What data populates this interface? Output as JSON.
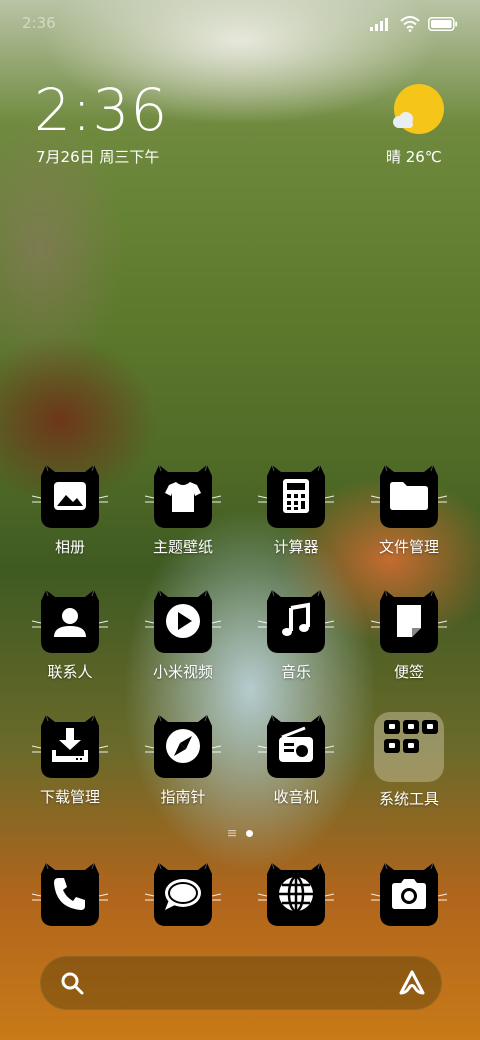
{
  "status_bar": {
    "time": "2:36",
    "battery_icon": "battery-icon",
    "wifi_icon": "wifi-icon",
    "signal_icon": "signal-icon"
  },
  "clock_widget": {
    "time": "2:36",
    "date": "7月26日 周三下午"
  },
  "weather": {
    "text": "晴 26℃",
    "icon": "sunny-cloud-icon"
  },
  "apps": [
    {
      "label": "相册",
      "icon": "gallery-icon"
    },
    {
      "label": "主题壁纸",
      "icon": "themes-icon"
    },
    {
      "label": "计算器",
      "icon": "calculator-icon"
    },
    {
      "label": "文件管理",
      "icon": "folder-icon"
    },
    {
      "label": "联系人",
      "icon": "contacts-icon"
    },
    {
      "label": "小米视频",
      "icon": "video-play-icon"
    },
    {
      "label": "音乐",
      "icon": "music-icon"
    },
    {
      "label": "便签",
      "icon": "notes-icon"
    },
    {
      "label": "下载管理",
      "icon": "download-icon"
    },
    {
      "label": "指南针",
      "icon": "compass-icon"
    },
    {
      "label": "收音机",
      "icon": "radio-icon"
    },
    {
      "label": "系统工具",
      "icon": "folder-group-icon"
    }
  ],
  "dock": [
    {
      "icon": "phone-icon"
    },
    {
      "icon": "messages-icon"
    },
    {
      "icon": "browser-icon"
    },
    {
      "icon": "camera-icon"
    }
  ],
  "search_bar": {
    "search_icon": "search-icon",
    "assistant_icon": "assistant-icon"
  },
  "page_indicator": {
    "pages": 2,
    "active": 2
  },
  "colors": {
    "icon_bg": "#000000",
    "glyph": "#ffffff",
    "sun": "#f6c51a"
  }
}
